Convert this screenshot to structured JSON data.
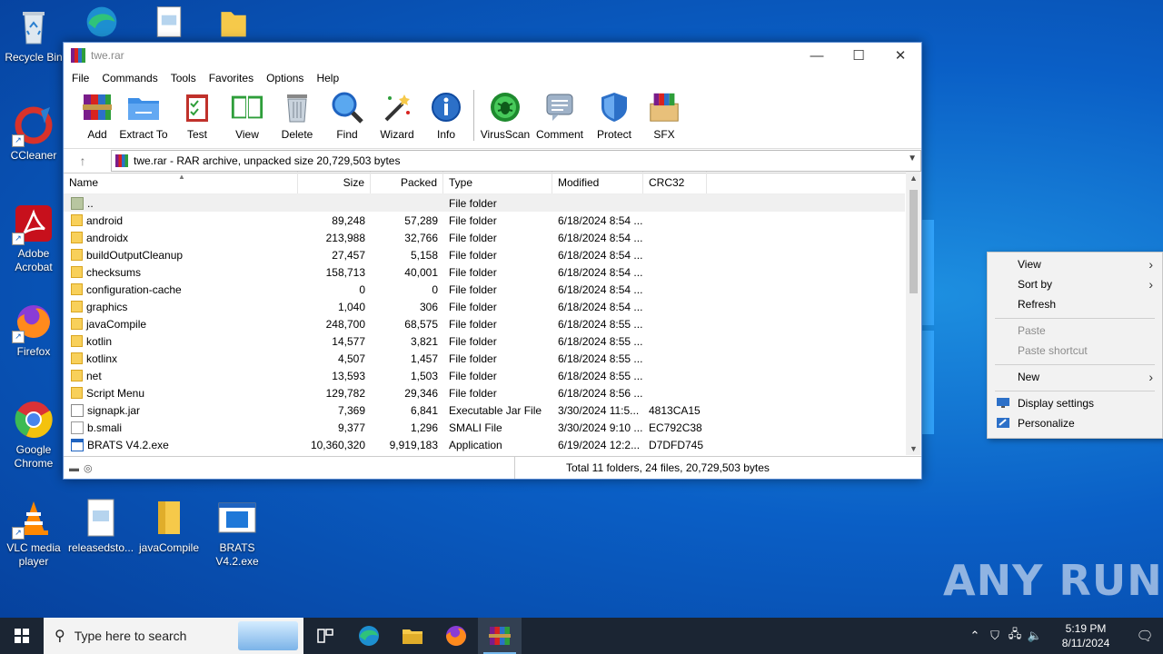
{
  "desktop": {
    "icons": [
      {
        "label": "Recycle Bin",
        "icon": "recycle-bin-icon"
      },
      {
        "label": "CCleaner",
        "icon": "ccleaner-icon"
      },
      {
        "label": "Adobe Acrobat",
        "icon": "adobe-acrobat-icon"
      },
      {
        "label": "Firefox",
        "icon": "firefox-icon"
      },
      {
        "label": "Google Chrome",
        "icon": "chrome-icon"
      },
      {
        "label": "VLC media player",
        "icon": "vlc-icon"
      },
      {
        "label": "releasedsto...",
        "icon": "document-icon"
      },
      {
        "label": "javaCompile",
        "icon": "folder-icon"
      },
      {
        "label": "BRATS V4.2.exe",
        "icon": "exe-icon"
      }
    ]
  },
  "window": {
    "title": "twe.rar",
    "menu": [
      "File",
      "Commands",
      "Tools",
      "Favorites",
      "Options",
      "Help"
    ],
    "toolbar": [
      "Add",
      "Extract To",
      "Test",
      "View",
      "Delete",
      "Find",
      "Wizard",
      "Info",
      "VirusScan",
      "Comment",
      "Protect",
      "SFX"
    ],
    "address": "twe.rar - RAR archive, unpacked size 20,729,503 bytes",
    "columns": [
      "Name",
      "Size",
      "Packed",
      "Type",
      "Modified",
      "CRC32"
    ],
    "rows": [
      {
        "name": "..",
        "size": "",
        "packed": "",
        "type": "File folder",
        "modified": "",
        "crc": "",
        "icon": "up"
      },
      {
        "name": "android",
        "size": "89,248",
        "packed": "57,289",
        "type": "File folder",
        "modified": "6/18/2024 8:54 ...",
        "crc": "",
        "icon": "folder"
      },
      {
        "name": "androidx",
        "size": "213,988",
        "packed": "32,766",
        "type": "File folder",
        "modified": "6/18/2024 8:54 ...",
        "crc": "",
        "icon": "folder"
      },
      {
        "name": "buildOutputCleanup",
        "size": "27,457",
        "packed": "5,158",
        "type": "File folder",
        "modified": "6/18/2024 8:54 ...",
        "crc": "",
        "icon": "folder"
      },
      {
        "name": "checksums",
        "size": "158,713",
        "packed": "40,001",
        "type": "File folder",
        "modified": "6/18/2024 8:54 ...",
        "crc": "",
        "icon": "folder"
      },
      {
        "name": "configuration-cache",
        "size": "0",
        "packed": "0",
        "type": "File folder",
        "modified": "6/18/2024 8:54 ...",
        "crc": "",
        "icon": "folder"
      },
      {
        "name": "graphics",
        "size": "1,040",
        "packed": "306",
        "type": "File folder",
        "modified": "6/18/2024 8:54 ...",
        "crc": "",
        "icon": "folder"
      },
      {
        "name": "javaCompile",
        "size": "248,700",
        "packed": "68,575",
        "type": "File folder",
        "modified": "6/18/2024 8:55 ...",
        "crc": "",
        "icon": "folder"
      },
      {
        "name": "kotlin",
        "size": "14,577",
        "packed": "3,821",
        "type": "File folder",
        "modified": "6/18/2024 8:55 ...",
        "crc": "",
        "icon": "folder"
      },
      {
        "name": "kotlinx",
        "size": "4,507",
        "packed": "1,457",
        "type": "File folder",
        "modified": "6/18/2024 8:55 ...",
        "crc": "",
        "icon": "folder"
      },
      {
        "name": "net",
        "size": "13,593",
        "packed": "1,503",
        "type": "File folder",
        "modified": "6/18/2024 8:55 ...",
        "crc": "",
        "icon": "folder"
      },
      {
        "name": "Script Menu",
        "size": "129,782",
        "packed": "29,346",
        "type": "File folder",
        "modified": "6/18/2024 8:56 ...",
        "crc": "",
        "icon": "folder"
      },
      {
        "name": "signapk.jar",
        "size": "7,369",
        "packed": "6,841",
        "type": "Executable Jar File",
        "modified": "3/30/2024 11:5...",
        "crc": "4813CA15",
        "icon": "jar"
      },
      {
        "name": "b.smali",
        "size": "9,377",
        "packed": "1,296",
        "type": "SMALI File",
        "modified": "3/30/2024 9:10 ...",
        "crc": "EC792C38",
        "icon": "file"
      },
      {
        "name": "BRATS V4.2.exe",
        "size": "10,360,320",
        "packed": "9,919,183",
        "type": "Application",
        "modified": "6/19/2024 12:2...",
        "crc": "D7DFD745",
        "icon": "exe"
      }
    ],
    "status": "Total 11 folders, 24 files, 20,729,503 bytes"
  },
  "context_menu": {
    "items": [
      {
        "label": "View",
        "submenu": true,
        "disabled": false
      },
      {
        "label": "Sort by",
        "submenu": true,
        "disabled": false
      },
      {
        "label": "Refresh",
        "submenu": false,
        "disabled": false
      },
      {
        "label": "Paste",
        "submenu": false,
        "disabled": true
      },
      {
        "label": "Paste shortcut",
        "submenu": false,
        "disabled": true
      },
      {
        "label": "New",
        "submenu": true,
        "disabled": false
      },
      {
        "label": "Display settings",
        "submenu": false,
        "disabled": false
      },
      {
        "label": "Personalize",
        "submenu": false,
        "disabled": false
      }
    ]
  },
  "taskbar": {
    "search_placeholder": "Type here to search",
    "time": "5:19 PM",
    "date": "8/11/2024"
  },
  "watermark": "ANY RUN",
  "colors": {
    "accent": "#0a5fc6",
    "taskbar": "#1b2533"
  }
}
